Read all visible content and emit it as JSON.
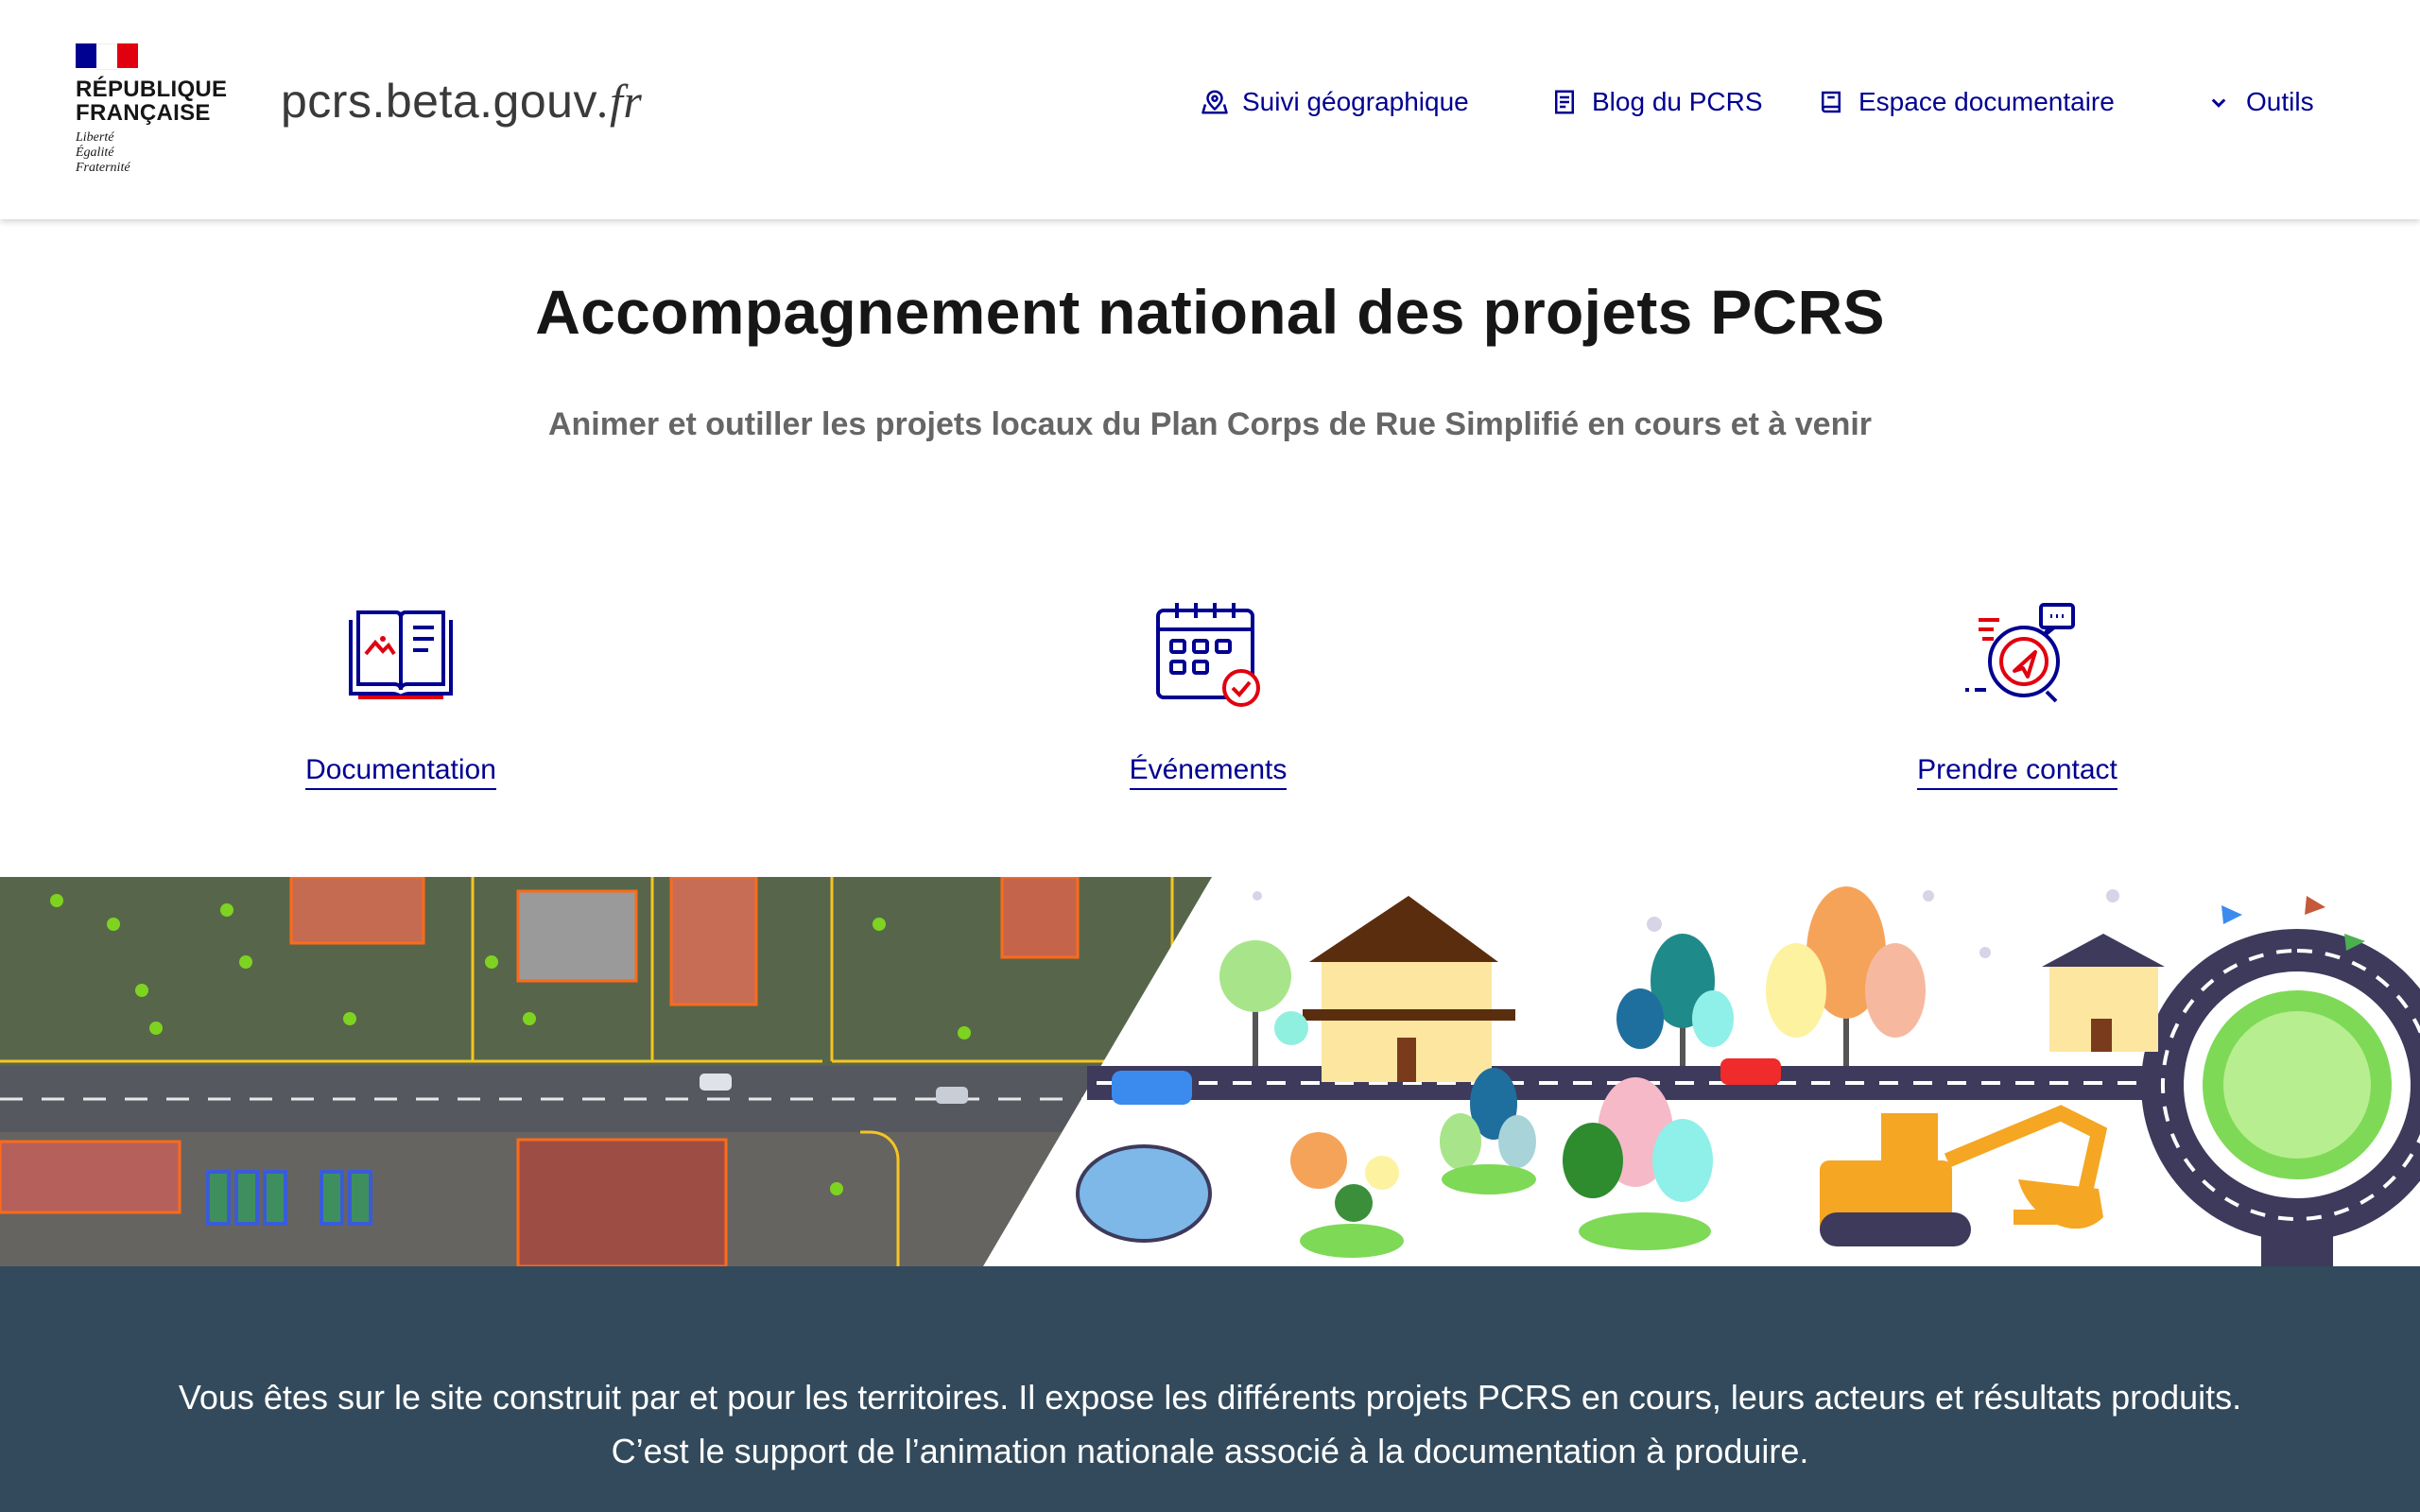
{
  "header": {
    "republic_line1": "RÉPUBLIQUE",
    "republic_line2": "FRANÇAISE",
    "motto": [
      "Liberté",
      "Égalité",
      "Fraternité"
    ],
    "site_name": "pcrs.beta.gouv",
    "site_tld": ".fr",
    "flag_colors": [
      "#000091",
      "#ffffff",
      "#e1000f"
    ],
    "nav": [
      {
        "label": "Suivi géographique",
        "icon": "map-pin-icon"
      },
      {
        "label": "Blog du PCRS",
        "icon": "article-icon"
      },
      {
        "label": "Espace documentaire",
        "icon": "book-icon"
      },
      {
        "label": "Outils",
        "icon": "chevron-down-icon"
      }
    ]
  },
  "hero": {
    "title": "Accompagnement national des projets PCRS",
    "subtitle": "Animer et outiller les projets locaux du Plan Corps de Rue Simplifié en cours et à venir"
  },
  "tiles": [
    {
      "label": "Documentation",
      "icon": "open-book-icon"
    },
    {
      "label": "Événements",
      "icon": "calendar-check-icon"
    },
    {
      "label": "Prendre contact",
      "icon": "contact-chat-icon"
    }
  ],
  "intro": {
    "text": "Vous êtes sur le site construit par et pour les territoires. Il expose les différents projets PCRS en cours, leurs acteurs et résultats produits. C’est le support de l’animation nationale associé à la documentation à produire."
  },
  "colors": {
    "primary": "#000091",
    "accent_red": "#e1000f",
    "intro_background": "#324a5c",
    "subtitle_grey": "#666666"
  }
}
